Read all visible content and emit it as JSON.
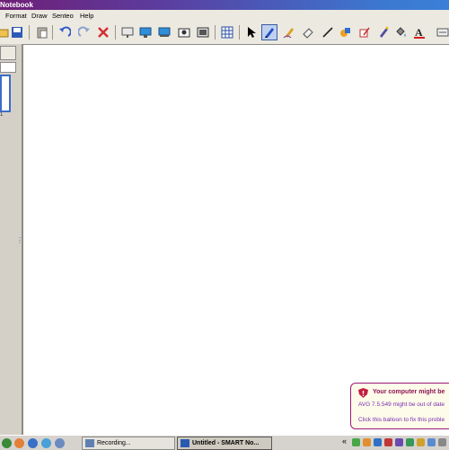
{
  "window": {
    "title": "Notebook"
  },
  "menu": [
    "Format",
    "Draw",
    "Senteo",
    "Help"
  ],
  "toolbar": {
    "buttons": [
      "undo-icon",
      "redo-icon",
      "delete-icon",
      "screen-shade-icon",
      "display-icon",
      "dual-display-icon",
      "capture-icon",
      "record-icon",
      "table-icon",
      "select-icon",
      "pen-icon",
      "creative-pen-icon",
      "eraser-icon",
      "line-icon",
      "shape-icon",
      "magic-pen-icon",
      "fill-icon",
      "text-icon"
    ],
    "active_tool": "pen-icon"
  },
  "side_panel": {
    "page_number": "1"
  },
  "notification": {
    "heading": "Your computer might be",
    "line1": "AVG 7.5.549 might be out of date",
    "line2": "Click this balloon to fix this proble"
  },
  "taskbar": {
    "chevron": "«",
    "tasks": [
      {
        "label": "Recording...",
        "active": false
      },
      {
        "label": "Untitled - SMART No...",
        "active": true
      }
    ]
  },
  "colors": {
    "title_gradient_start": "#6f1f76",
    "title_gradient_end": "#3a7fd8",
    "balloon_border": "#9c1b78",
    "balloon_heading": "#8e1555",
    "balloon_text": "#7a2cb0"
  }
}
